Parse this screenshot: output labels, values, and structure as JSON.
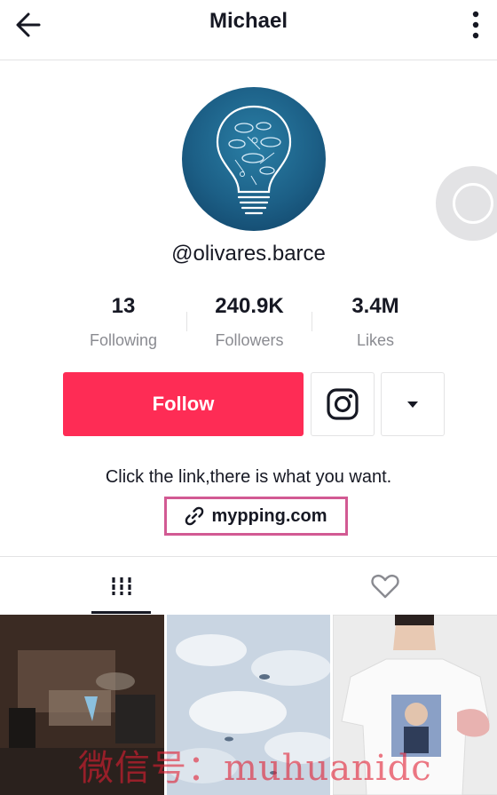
{
  "header": {
    "title": "Michael",
    "back_icon": "arrow-left-icon",
    "more_icon": "more-vertical-icon"
  },
  "profile": {
    "username": "@olivares.barce",
    "avatar_icon": "lightbulb-avatar"
  },
  "stats": [
    {
      "value": "13",
      "label": "Following"
    },
    {
      "value": "240.9K",
      "label": "Followers"
    },
    {
      "value": "3.4M",
      "label": "Likes"
    }
  ],
  "actions": {
    "follow_label": "Follow",
    "instagram_icon": "instagram-icon",
    "dropdown_icon": "caret-down-icon"
  },
  "bio": {
    "text": "Click the link,there is what you want.",
    "link_text": "mypping.com",
    "link_icon": "link-icon"
  },
  "tabs": [
    {
      "name": "videos",
      "icon": "grid-icon",
      "active": true
    },
    {
      "name": "liked",
      "icon": "heart-outline-icon",
      "active": false
    }
  ],
  "videos": [
    {
      "thumbnail": "dark-room-scene"
    },
    {
      "thumbnail": "snow-scene"
    },
    {
      "thumbnail": "person-tshirt-scene"
    }
  ],
  "watermark": "微信号：muhuanidc",
  "colors": {
    "accent": "#fe2c55",
    "link_highlight": "#d25a93",
    "text_primary": "#161823",
    "text_secondary": "#8a8b91"
  }
}
